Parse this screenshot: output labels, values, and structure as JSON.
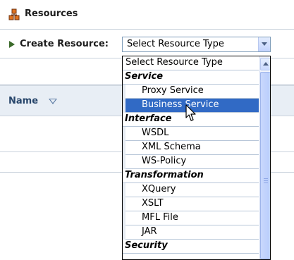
{
  "header": {
    "title": "Resources",
    "icon": "resources-icon"
  },
  "create": {
    "label": "Create Resource:",
    "select_value": "Select Resource Type",
    "expand_icon": "triangle-right-icon"
  },
  "table": {
    "name_header": "Name",
    "sort_icon": "sort-down-icon"
  },
  "dropdown": {
    "top_option": "Select Resource Type",
    "groups": [
      {
        "label": "Service",
        "items": [
          "Proxy Service",
          "Business Service"
        ]
      },
      {
        "label": "Interface",
        "items": [
          "WSDL",
          "XML Schema",
          "WS-Policy"
        ]
      },
      {
        "label": "Transformation",
        "items": [
          "XQuery",
          "XSLT",
          "MFL File",
          "JAR"
        ]
      },
      {
        "label": "Security",
        "items": []
      }
    ],
    "selected_item": "Business Service",
    "selection_color": "#316ac5"
  }
}
